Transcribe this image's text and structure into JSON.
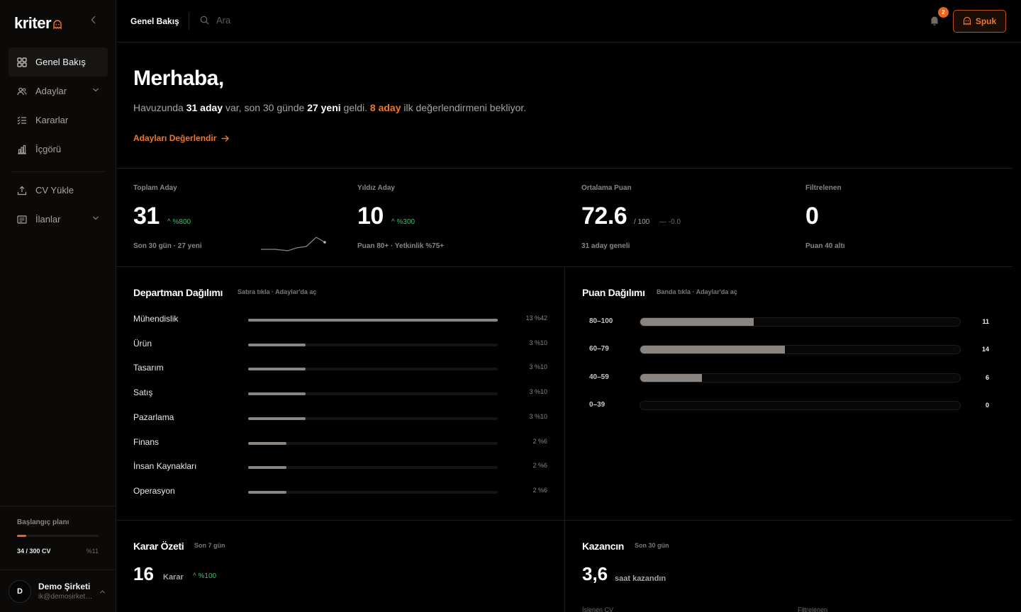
{
  "sidebar": {
    "logo": "kriter",
    "items": [
      {
        "label": "Genel Bakış"
      },
      {
        "label": "Adaylar"
      },
      {
        "label": "Kararlar"
      },
      {
        "label": "İçgörü"
      },
      {
        "label": "CV Yükle"
      },
      {
        "label": "İlanlar"
      }
    ],
    "plan": {
      "label": "Başlangıç planı",
      "count": "34 / 300 CV",
      "percent": "%11",
      "fraction": 0.11
    },
    "user": {
      "initial": "D",
      "name": "Demo Şirketi",
      "email": "ik@demosirketi.com"
    }
  },
  "topbar": {
    "title": "Genel Bakış",
    "search_placeholder": "Ara",
    "notifications": "2",
    "spuk_label": "Spuk"
  },
  "hero": {
    "greeting": "Merhaba,",
    "sub_1": "Havuzunda ",
    "sub_count": "31 aday",
    "sub_2": " var, son 30 günde ",
    "sub_new": "27 yeni",
    "sub_3": " geldi. ",
    "sub_pending": "8 aday",
    "sub_4": " ilk değerlendirmeni bekliyor.",
    "cta": "Adayları Değerlendir"
  },
  "stats": [
    {
      "label": "Toplam Aday",
      "value": "31",
      "delta": "%800",
      "foot": "Son 30 gün · 27 yeni"
    },
    {
      "label": "Yıldız Aday",
      "value": "10",
      "delta": "%300",
      "foot": "Puan 80+ · Yetkinlik %75+"
    },
    {
      "label": "Ortalama Puan",
      "value": "72.6",
      "unit": "/ 100",
      "delta": "-0.0",
      "foot": "31 aday geneli"
    },
    {
      "label": "Filtrelenen",
      "value": "0",
      "foot": "Puan 40 altı"
    }
  ],
  "department": {
    "title": "Departman Dağılımı",
    "hint": "Satıra tıkla · Adaylar'da aç",
    "rows": [
      {
        "name": "Mühendislik",
        "count": 13,
        "label": "13 %42"
      },
      {
        "name": "Ürün",
        "count": 3,
        "label": "3 %10"
      },
      {
        "name": "Tasarım",
        "count": 3,
        "label": "3 %10"
      },
      {
        "name": "Satış",
        "count": 3,
        "label": "3 %10"
      },
      {
        "name": "Pazarlama",
        "count": 3,
        "label": "3 %10"
      },
      {
        "name": "Finans",
        "count": 2,
        "label": "2 %6"
      },
      {
        "name": "İnsan Kaynakları",
        "count": 2,
        "label": "2 %6"
      },
      {
        "name": "Operasyon",
        "count": 2,
        "label": "2 %6"
      }
    ]
  },
  "score": {
    "title": "Puan Dağılımı",
    "hint": "Banda tıkla · Adaylar'da aç",
    "rows": [
      {
        "band": "80–100",
        "count": 11,
        "label": "11"
      },
      {
        "band": "60–79",
        "count": 14,
        "label": "14"
      },
      {
        "band": "40–59",
        "count": 6,
        "label": "6"
      },
      {
        "band": "0–39",
        "count": 0,
        "label": "0"
      }
    ]
  },
  "decision": {
    "title": "Karar Özeti",
    "hint": "Son 7 gün",
    "value": "16",
    "unit": "Karar",
    "delta": "%100"
  },
  "gain": {
    "title": "Kazancın",
    "hint": "Son 30 gün",
    "value": "3,6",
    "unit": "saat kazandın",
    "label_a": "İşlenen CV",
    "label_b": "Filtrelenen"
  },
  "colors": {
    "accent": "#e8651a",
    "positive": "#3bbf6a",
    "bar": "#8a8580"
  }
}
